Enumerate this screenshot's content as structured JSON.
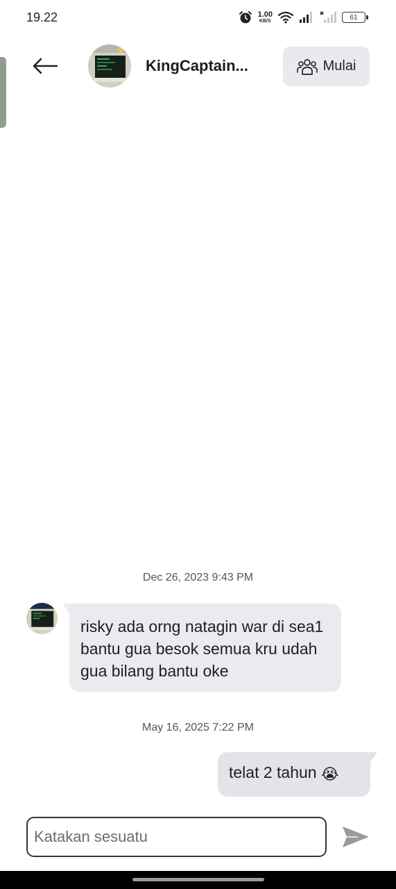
{
  "status_bar": {
    "time": "19.22",
    "net_speed_value": "1.00",
    "net_speed_unit": "KB/S",
    "battery": "61",
    "icons": [
      "alarm-icon",
      "wifi-icon",
      "signal-icon",
      "signal-x-icon",
      "battery-icon"
    ]
  },
  "header": {
    "back_icon": "arrow-left-icon",
    "contact_name": "KingCaptain...",
    "start_button_label": "Mulai",
    "start_button_icon": "group-icon"
  },
  "messages": [
    {
      "type": "timestamp",
      "text": "Dec 26, 2023 9:43 PM"
    },
    {
      "type": "incoming",
      "text": "risky ada orng natagin war di sea1 bantu gua besok semua kru udah gua bilang bantu oke"
    },
    {
      "type": "timestamp",
      "text": "May 16, 2025 7:22 PM"
    },
    {
      "type": "outgoing",
      "text": "telat 2 tahun",
      "emoji": "😭"
    }
  ],
  "composer": {
    "placeholder": "Katakan sesuatu",
    "value": "",
    "send_icon": "send-icon"
  },
  "colors": {
    "incoming_bubble": "#ebebef",
    "outgoing_bubble": "#e3e3e9",
    "start_button_bg": "#e9e9ee",
    "nav_bar": "#000000"
  }
}
